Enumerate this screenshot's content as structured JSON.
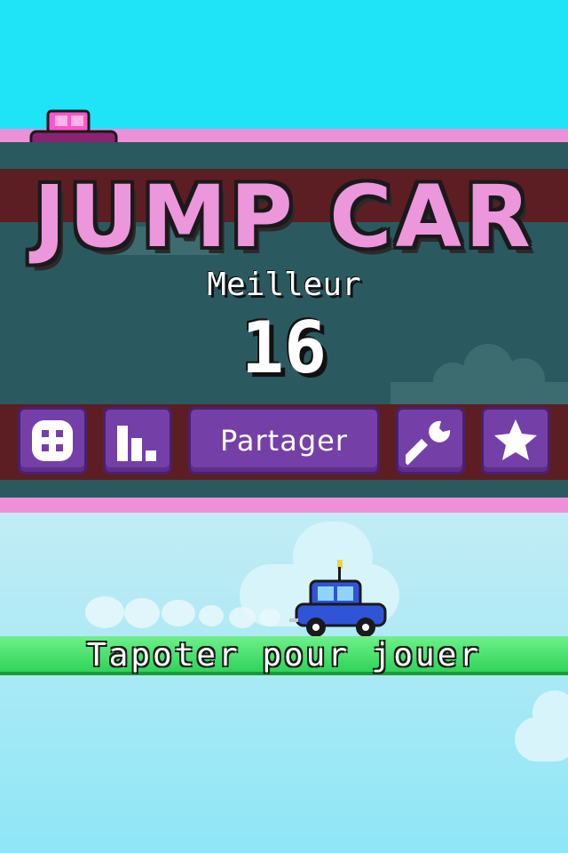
{
  "game": {
    "title": "JUMP CAR",
    "best_label": "Meilleur",
    "best_score": "16"
  },
  "buttons": {
    "menu_icon": "dots-grid-icon",
    "leaderboard_icon": "bar-chart-icon",
    "share_label": "Partager",
    "settings_icon": "wrench-icon",
    "rate_icon": "star-icon"
  },
  "prompt": {
    "tap_label": "Tapoter pour jouer"
  },
  "colors": {
    "sky_top": "#1fe3f7",
    "title_pink": "#ec96dc",
    "button_purple": "#7440a8",
    "tap_bar_green": "#2fd45a"
  }
}
